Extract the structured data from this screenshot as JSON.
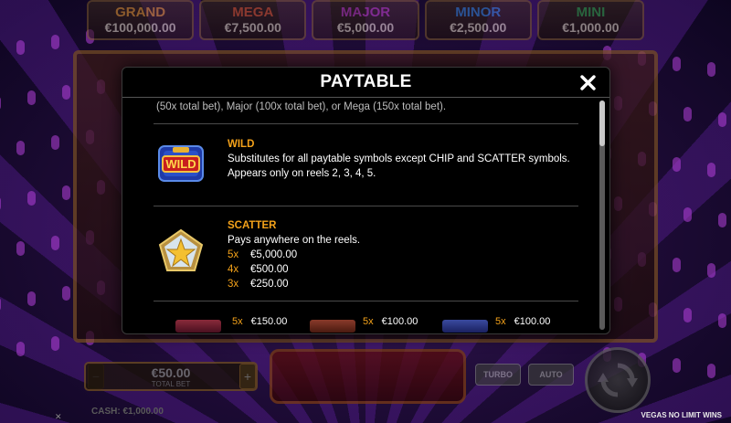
{
  "jackpots": [
    {
      "name": "GRAND",
      "value": "€100,000.00"
    },
    {
      "name": "MEGA",
      "value": "€7,500.00"
    },
    {
      "name": "MAJOR",
      "value": "€5,000.00"
    },
    {
      "name": "MINOR",
      "value": "€2,500.00"
    },
    {
      "name": "MINI",
      "value": "€1,000.00"
    }
  ],
  "paytable": {
    "title": "PAYTABLE",
    "intro_text": "(50x total bet), Major (100x total bet), or Mega (150x total bet).",
    "wild": {
      "icon": "wild-symbol-icon",
      "title": "WILD",
      "description": "Substitutes for all paytable symbols except CHIP and SCATTER symbols.",
      "note": "Appears only on reels 2, 3, 4, 5."
    },
    "scatter": {
      "icon": "star-scatter-icon",
      "title": "SCATTER",
      "description": "Pays anywhere on the reels.",
      "pays": [
        {
          "mult": "5x",
          "value": "€5,000.00"
        },
        {
          "mult": "4x",
          "value": "€500.00"
        },
        {
          "mult": "3x",
          "value": "€250.00"
        }
      ]
    },
    "partial_row": [
      {
        "mult": "5x",
        "value": "€150.00"
      },
      {
        "mult": "5x",
        "value": "€100.00"
      },
      {
        "mult": "5x",
        "value": "€100.00"
      }
    ]
  },
  "controls": {
    "bet_amount": "€50.00",
    "bet_label": "TOTAL BET",
    "turbo_label": "TURBO",
    "auto_label": "AUTO",
    "cash_text": "CASH: €1,000.00",
    "game_title": "VEGAS NO LIMIT WINS"
  },
  "colors": {
    "accent_orange": "#f4a21a",
    "modal_bg": "#000000",
    "text": "#ffffff"
  }
}
